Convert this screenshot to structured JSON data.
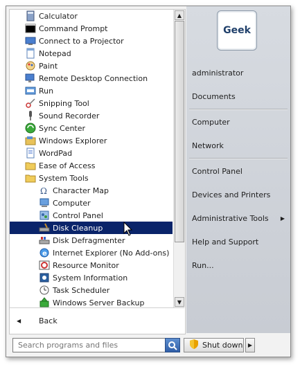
{
  "programs": [
    {
      "label": "Calculator",
      "icon": "calculator-icon",
      "indent": 0
    },
    {
      "label": "Command Prompt",
      "icon": "command-prompt-icon",
      "indent": 0
    },
    {
      "label": "Connect to a Projector",
      "icon": "projector-icon",
      "indent": 0
    },
    {
      "label": "Notepad",
      "icon": "notepad-icon",
      "indent": 0
    },
    {
      "label": "Paint",
      "icon": "paint-icon",
      "indent": 0
    },
    {
      "label": "Remote Desktop Connection",
      "icon": "remote-desktop-icon",
      "indent": 0
    },
    {
      "label": "Run",
      "icon": "run-icon",
      "indent": 0
    },
    {
      "label": "Snipping Tool",
      "icon": "scissors-icon",
      "indent": 0
    },
    {
      "label": "Sound Recorder",
      "icon": "microphone-icon",
      "indent": 0
    },
    {
      "label": "Sync Center",
      "icon": "sync-icon",
      "indent": 0
    },
    {
      "label": "Windows Explorer",
      "icon": "explorer-icon",
      "indent": 0
    },
    {
      "label": "WordPad",
      "icon": "wordpad-icon",
      "indent": 0
    },
    {
      "label": "Ease of Access",
      "icon": "folder-icon",
      "indent": 0
    },
    {
      "label": "System Tools",
      "icon": "folder-icon",
      "indent": 0
    },
    {
      "label": "Character Map",
      "icon": "character-map-icon",
      "indent": 1
    },
    {
      "label": "Computer",
      "icon": "computer-icon",
      "indent": 1
    },
    {
      "label": "Control Panel",
      "icon": "control-panel-icon",
      "indent": 1
    },
    {
      "label": "Disk Cleanup",
      "icon": "disk-cleanup-icon",
      "indent": 1,
      "selected": true
    },
    {
      "label": "Disk Defragmenter",
      "icon": "disk-defragmenter-icon",
      "indent": 1
    },
    {
      "label": "Internet Explorer (No Add-ons)",
      "icon": "internet-explorer-icon",
      "indent": 1
    },
    {
      "label": "Resource Monitor",
      "icon": "resource-monitor-icon",
      "indent": 1
    },
    {
      "label": "System Information",
      "icon": "system-information-icon",
      "indent": 1
    },
    {
      "label": "Task Scheduler",
      "icon": "clock-icon",
      "indent": 1
    },
    {
      "label": "Windows Server Backup",
      "icon": "backup-icon",
      "indent": 1
    }
  ],
  "back_label": "Back",
  "search_placeholder": "Search programs and files",
  "avatar_text": "Geek",
  "right_items": [
    {
      "label": "administrator"
    },
    {
      "label": "Documents"
    },
    {
      "label": "Computer"
    },
    {
      "label": "Network"
    },
    {
      "label": "Control Panel"
    },
    {
      "label": "Devices and Printers"
    },
    {
      "label": "Administrative Tools",
      "submenu": true
    },
    {
      "label": "Help and Support"
    },
    {
      "label": "Run..."
    }
  ],
  "shutdown_label": "Shut down",
  "colors": {
    "selection": "#0a246a",
    "right_panel": "#d0d4da"
  }
}
